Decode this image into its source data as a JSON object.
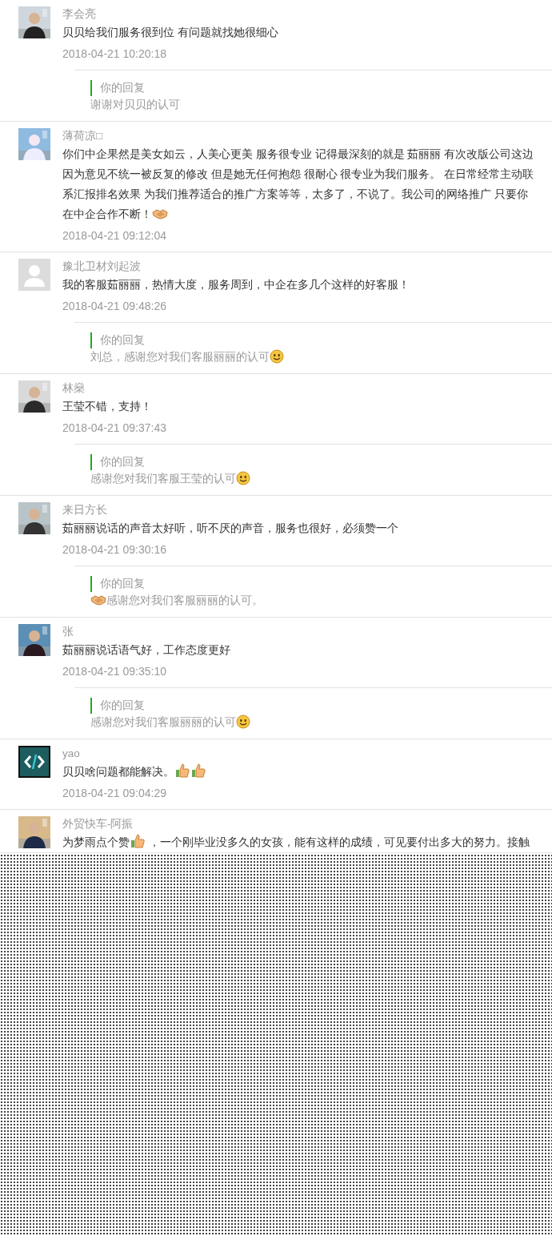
{
  "comments": [
    {
      "avatar": {
        "kind": "picture"
      },
      "name": "李会亮",
      "body": [
        {
          "kind": "text",
          "text": "贝贝给我们服务很到位 有问题就找她很细心"
        }
      ],
      "date": "2018-04-21 10:20:18",
      "reply": {
        "label": "你的回复",
        "body": [
          {
            "kind": "text",
            "text": "谢谢对贝贝的认可"
          }
        ]
      }
    },
    {
      "avatar": {
        "kind": "picture"
      },
      "name": "薄荷凉□",
      "body": [
        {
          "kind": "text",
          "text": "你们中企果然是美女如云，人美心更美 服务很专业 记得最深刻的就是 茹丽丽 有次改版公司这边因为意见不统一被反复的修改 但是她无任何抱怨 很耐心 很专业为我们服务。 在日常经常主动联系汇报排名效果 为我们推荐适合的推广方案等等，太多了，不说了。我公司的网络推广 只要你在中企合作不断！"
        },
        {
          "kind": "handshake"
        }
      ],
      "date": "2018-04-21 09:12:04"
    },
    {
      "avatar": {
        "kind": "default"
      },
      "name": "豫北卫材刘起波",
      "body": [
        {
          "kind": "text",
          "text": "我的客服茹丽丽，热情大度，服务周到，中企在多几个这样的好客服！"
        }
      ],
      "date": "2018-04-21 09:48:26",
      "reply": {
        "label": "你的回复",
        "body": [
          {
            "kind": "text",
            "text": "刘总，感谢您对我们客服丽丽的认可"
          },
          {
            "kind": "smile"
          }
        ]
      }
    },
    {
      "avatar": {
        "kind": "picture"
      },
      "name": "林燊",
      "body": [
        {
          "kind": "text",
          "text": "王莹不错，支持！"
        }
      ],
      "date": "2018-04-21 09:37:43",
      "reply": {
        "label": "你的回复",
        "body": [
          {
            "kind": "text",
            "text": "感谢您对我们客服王莹的认可"
          },
          {
            "kind": "smile"
          }
        ]
      }
    },
    {
      "avatar": {
        "kind": "picture"
      },
      "name": "来日方长",
      "body": [
        {
          "kind": "text",
          "text": "茹丽丽说话的声音太好听，听不厌的声音，服务也很好，必须赞一个"
        }
      ],
      "date": "2018-04-21 09:30:16",
      "reply": {
        "label": "你的回复",
        "body": [
          {
            "kind": "handshake"
          },
          {
            "kind": "text",
            "text": "感谢您对我们客服丽丽的认可。"
          }
        ]
      }
    },
    {
      "avatar": {
        "kind": "picture"
      },
      "name": "张",
      "body": [
        {
          "kind": "text",
          "text": "茹丽丽说话语气好，工作态度更好"
        }
      ],
      "date": "2018-04-21 09:35:10",
      "reply": {
        "label": "你的回复",
        "body": [
          {
            "kind": "text",
            "text": "感谢您对我们客服丽丽的认可"
          },
          {
            "kind": "smile"
          }
        ]
      }
    },
    {
      "avatar": {
        "kind": "code"
      },
      "name": "yao",
      "body": [
        {
          "kind": "text",
          "text": "贝贝啥问题都能解决。"
        },
        {
          "kind": "thumb"
        },
        {
          "kind": "thumb"
        }
      ],
      "date": "2018-04-21 09:04:29"
    },
    {
      "avatar": {
        "kind": "picture"
      },
      "name": "外贸快车-阿振",
      "body": [
        {
          "kind": "text",
          "text": "为梦雨点个赞"
        },
        {
          "kind": "thumb"
        },
        {
          "kind": "text",
          "text": " ，一个刚毕业没多久的女孩，能有这样的成绩，可见要付出多大的努力。接触"
        }
      ]
    }
  ]
}
